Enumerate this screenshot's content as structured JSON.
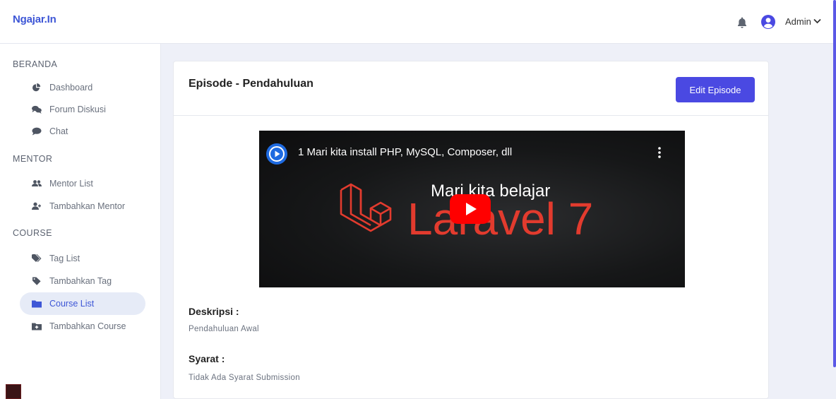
{
  "navbar": {
    "brand": "Ngajar.In",
    "user_name": "Admin",
    "icons": {
      "notifications": "bell-icon",
      "avatar": "user-circle-icon",
      "menu": "chevron-down-icon"
    }
  },
  "sidebar": {
    "sections": [
      {
        "title": "BERANDA",
        "items": [
          {
            "label": "Dashboard",
            "icon": "chart-pie-icon"
          },
          {
            "label": "Forum Diskusi",
            "icon": "comments-icon"
          },
          {
            "label": "Chat",
            "icon": "comment-icon"
          }
        ]
      },
      {
        "title": "MENTOR",
        "items": [
          {
            "label": "Mentor List",
            "icon": "users-icon"
          },
          {
            "label": "Tambahkan Mentor",
            "icon": "user-plus-icon"
          }
        ]
      },
      {
        "title": "COURSE",
        "items": [
          {
            "label": "Tag List",
            "icon": "tags-icon"
          },
          {
            "label": "Tambahkan Tag",
            "icon": "tag-icon"
          },
          {
            "label": "Course List",
            "icon": "folder-icon",
            "active": true
          },
          {
            "label": "Tambahkan Course",
            "icon": "folder-plus-icon"
          }
        ]
      }
    ]
  },
  "card": {
    "title": "Episode - Pendahuluan",
    "edit_button": "Edit Episode",
    "video": {
      "title": "1 Mari kita install PHP, MySQL, Composer, dll",
      "subtitle": "Mari kita belajar",
      "heading": "Laravel 7"
    },
    "description_label": "Deskripsi :",
    "description_value": "Pendahuluan Awal",
    "requirement_label": "Syarat :",
    "requirement_value": "Tidak Ada Syarat Submission"
  },
  "colors": {
    "brand": "#3d56d6",
    "primary_button": "#4a49e2",
    "active_item_bg": "#e6ebf7",
    "laravel_red": "#e23b2e"
  }
}
